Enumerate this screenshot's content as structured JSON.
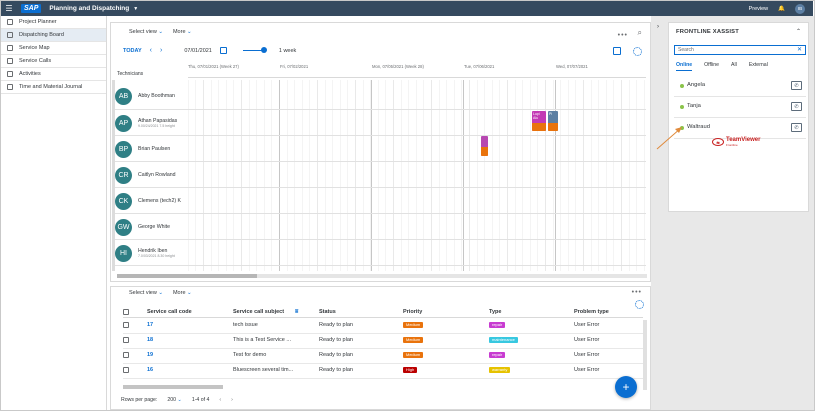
{
  "shell": {
    "title": "Planning and Dispatching",
    "logo": "SAP",
    "preview": "Preview",
    "user": "IB",
    "menu_icon": "hamburger-icon"
  },
  "nav": {
    "items": [
      {
        "label": "Project Planner",
        "active": false
      },
      {
        "label": "Dispatching Board",
        "active": true
      },
      {
        "label": "Service Map",
        "active": false
      },
      {
        "label": "Service Calls",
        "active": false
      },
      {
        "label": "Activities",
        "active": false
      },
      {
        "label": "Time and Material Journal",
        "active": false
      }
    ]
  },
  "board": {
    "select_view": "Select view",
    "more": "More",
    "today": "TODAY",
    "date": "07/01/2021",
    "range": "1 week",
    "technicians_header": "Technicians",
    "days": [
      "Thu, 07/01/2021 (Week 27)",
      "Fri, 07/02/2021",
      "Mon, 07/05/2021 (Week 28)",
      "Tue, 07/06/2021",
      "Wed, 07/07/2021"
    ],
    "technicians": [
      {
        "initials": "AB",
        "name": "Abby Boothman",
        "sub": ""
      },
      {
        "initials": "AP",
        "name": "Athan Papasidas",
        "sub": "9.00/24/2021 7.5 height"
      },
      {
        "initials": "BP",
        "name": "Brian Paulsen",
        "sub": ""
      },
      {
        "initials": "CR",
        "name": "Caitlyn Rowland",
        "sub": ""
      },
      {
        "initials": "CK",
        "name": "Clemens (tech2) K",
        "sub": ""
      },
      {
        "initials": "GW",
        "name": "George White",
        "sub": ""
      },
      {
        "initials": "HI",
        "name": "Hendrik Iben",
        "sub": "7.0/03/2021 8.30 height"
      }
    ],
    "events": [
      {
        "label": "Lupi Alu",
        "color": "#c33ab4"
      },
      {
        "label": "Pi",
        "color": "#5c7fa3"
      },
      {
        "label": "",
        "color": "#b748b1"
      }
    ]
  },
  "table": {
    "select_view": "Select view",
    "more": "More",
    "headers": [
      "Service call code",
      "Service call subject",
      "Status",
      "Priority",
      "Type",
      "Problem type"
    ],
    "rows": [
      {
        "code": "17",
        "subject": "tech issue",
        "status": "Ready to plan",
        "priority": "Medium",
        "type": "repair",
        "problem": "User Error"
      },
      {
        "code": "18",
        "subject": "This is a Test Service ...",
        "status": "Ready to plan",
        "priority": "Medium",
        "type": "maintenance",
        "problem": "User Error"
      },
      {
        "code": "19",
        "subject": "Test for demo",
        "status": "Ready to plan",
        "priority": "Medium",
        "type": "repair",
        "problem": "User Error"
      },
      {
        "code": "16",
        "subject": "Bluescreen several tim...",
        "status": "Ready to plan",
        "priority": "High",
        "type": "warranty",
        "problem": "User Error"
      }
    ],
    "rows_per_page_label": "Rows per page:",
    "rows_per_page": "200",
    "pagination": "1-4 of 4",
    "colors": {
      "medium": "#e9730c",
      "high": "#bb0000",
      "repair": "#c83cd1",
      "maintenance": "#38c8e0",
      "warranty": "#e6c200"
    }
  },
  "panel": {
    "title": "FRONTLINE XASSIST",
    "search_placeholder": "Search",
    "tabs": [
      "Online",
      "Offline",
      "All",
      "External"
    ],
    "contacts": [
      "Angela",
      "Tanja",
      "Waltraud"
    ],
    "teamviewer_brand": "TeamViewer",
    "teamviewer_sub": "Frontline"
  }
}
